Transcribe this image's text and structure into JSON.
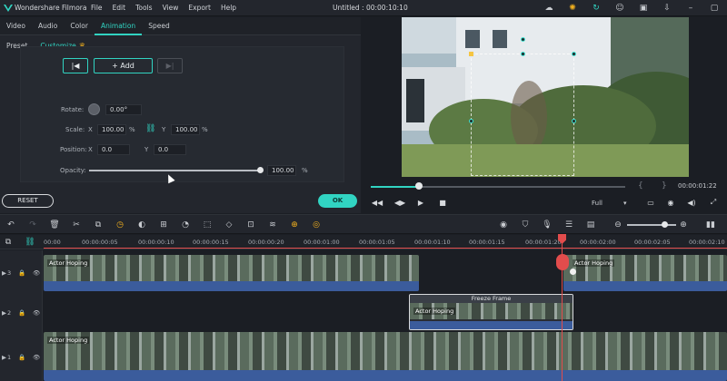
{
  "app": {
    "name": "Wondershare Filmora",
    "window_title": "Untitled : 00:00:10:10",
    "menu": [
      "File",
      "Edit",
      "Tools",
      "View",
      "Export",
      "Help"
    ]
  },
  "panel": {
    "tabs": [
      "Video",
      "Audio",
      "Color",
      "Animation",
      "Speed"
    ],
    "active_tab": "Animation",
    "subtabs": [
      "Preset",
      "Customize"
    ],
    "active_subtab": "Customize",
    "keyframe": {
      "add_label": "+ Add"
    },
    "rotate": {
      "label": "Rotate:",
      "value": "0.00°"
    },
    "scale": {
      "label": "Scale:",
      "x_label": "X",
      "x_value": "100.00",
      "x_unit": "%",
      "y_label": "Y",
      "y_value": "100.00",
      "y_unit": "%"
    },
    "position": {
      "label": "Position:",
      "x_label": "X",
      "x_value": "0.0",
      "y_label": "Y",
      "y_value": "0.0"
    },
    "opacity": {
      "label": "Opacity:",
      "value": "100.00",
      "unit": "%",
      "level": 1.0
    },
    "reset_label": "RESET",
    "ok_label": "OK"
  },
  "preview": {
    "timecode": "00:00:01:22",
    "progress": 0.19,
    "zoom": "Full"
  },
  "timeline": {
    "ruler_labels": [
      "00:00",
      "00:00:00:05",
      "00:00:00:10",
      "00:00:00:15",
      "00:00:00:20",
      "00:00:01:00",
      "00:00:01:05",
      "00:00:01:10",
      "00:00:01:15",
      "00:00:01:20",
      "00:00:02:00",
      "00:00:02:05",
      "00:00:02:10"
    ],
    "tracks": [
      {
        "number": "3",
        "clip_label": "Actor Hoping"
      },
      {
        "number": "2",
        "clip_label": "Actor Hoping",
        "freeze_title": "Freeze Frame"
      },
      {
        "number": "1",
        "clip_label": "Actor Hoping"
      }
    ]
  },
  "colors": {
    "accent": "#31d4c2",
    "playhead": "#e24c4c",
    "audio": "#3b5c9c"
  }
}
